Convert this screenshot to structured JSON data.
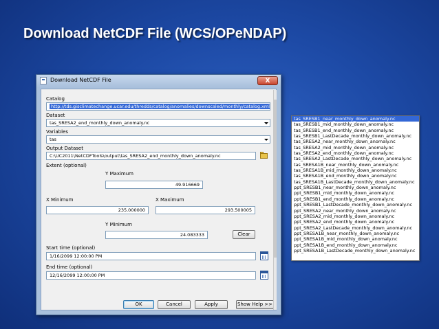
{
  "slide": {
    "title": "Download NetCDF File (WCS/OPeNDAP)"
  },
  "dialog": {
    "title": "Download NetCDF File",
    "close_label": "X",
    "catalog": {
      "label": "Catalog",
      "value": "http://tds.gisclimatechange.ucar.edu/thredds/catalog/anomalies/downscaled/monthly/catalog.xml"
    },
    "dataset": {
      "label": "Dataset",
      "value": "tas_SRESA2_end_monthly_down_anomaly.nc"
    },
    "variables": {
      "label": "Variables",
      "value": "tas"
    },
    "output_dataset": {
      "label": "Output Dataset",
      "value": "C:\\UC2011\\NetCDFTools\\output\\tas_SRESA2_end_monthly_down_anomaly.nc"
    },
    "extent": {
      "label": "Extent (optional)",
      "y_max_label": "Y Maximum",
      "y_max": "49.916669",
      "x_min_label": "X Minimum",
      "x_min": "235.000000",
      "x_max_label": "X Maximum",
      "x_max": "293.500005",
      "y_min_label": "Y Minimum",
      "y_min": "24.083333",
      "clear_label": "Clear"
    },
    "start_time": {
      "label": "Start time (optional)",
      "value": "1/16/2099 12:00:00 PM"
    },
    "end_time": {
      "label": "End time (optional)",
      "value": "12/16/2099 12:00:00 PM"
    },
    "buttons": {
      "ok": "OK",
      "cancel": "Cancel",
      "apply": "Apply",
      "help": "Show Help >>"
    }
  },
  "dataset_dropdown": {
    "items": [
      "tas_SRESB1_near_monthly_down_anomaly.nc",
      "tas_SRESB1_mid_monthly_down_anomaly.nc",
      "tas_SRESB1_end_monthly_down_anomaly.nc",
      "tas_SRESB1_LastDecade_monthly_down_anomaly.nc",
      "tas_SRESA2_near_monthly_down_anomaly.nc",
      "tas_SRESA2_mid_monthly_down_anomaly.nc",
      "tas_SRESA2_end_monthly_down_anomaly.nc",
      "tas_SRESA2_LastDecade_monthly_down_anomaly.nc",
      "tas_SRESA1B_near_monthly_down_anomaly.nc",
      "tas_SRESA1B_mid_monthly_down_anomaly.nc",
      "tas_SRESA1B_end_monthly_down_anomaly.nc",
      "tas_SRESA1B_LastDecade_monthly_down_anomaly.nc",
      "ppt_SRESB1_near_monthly_down_anomaly.nc",
      "ppt_SRESB1_mid_monthly_down_anomaly.nc",
      "ppt_SRESB1_end_monthly_down_anomaly.nc",
      "ppt_SRESB1_LastDecade_monthly_down_anomaly.nc",
      "ppt_SRESA2_near_monthly_down_anomaly.nc",
      "ppt_SRESA2_mid_monthly_down_anomaly.nc",
      "ppt_SRESA2_end_monthly_down_anomaly.nc",
      "ppt_SRESA2_LastDecade_monthly_down_anomaly.nc",
      "ppt_SRESA1B_near_monthly_down_anomaly.nc",
      "ppt_SRESA1B_mid_monthly_down_anomaly.nc",
      "ppt_SRESA1B_end_monthly_down_anomaly.nc",
      "ppt_SRESA1B_LastDecade_monthly_down_anomaly.nc"
    ]
  }
}
